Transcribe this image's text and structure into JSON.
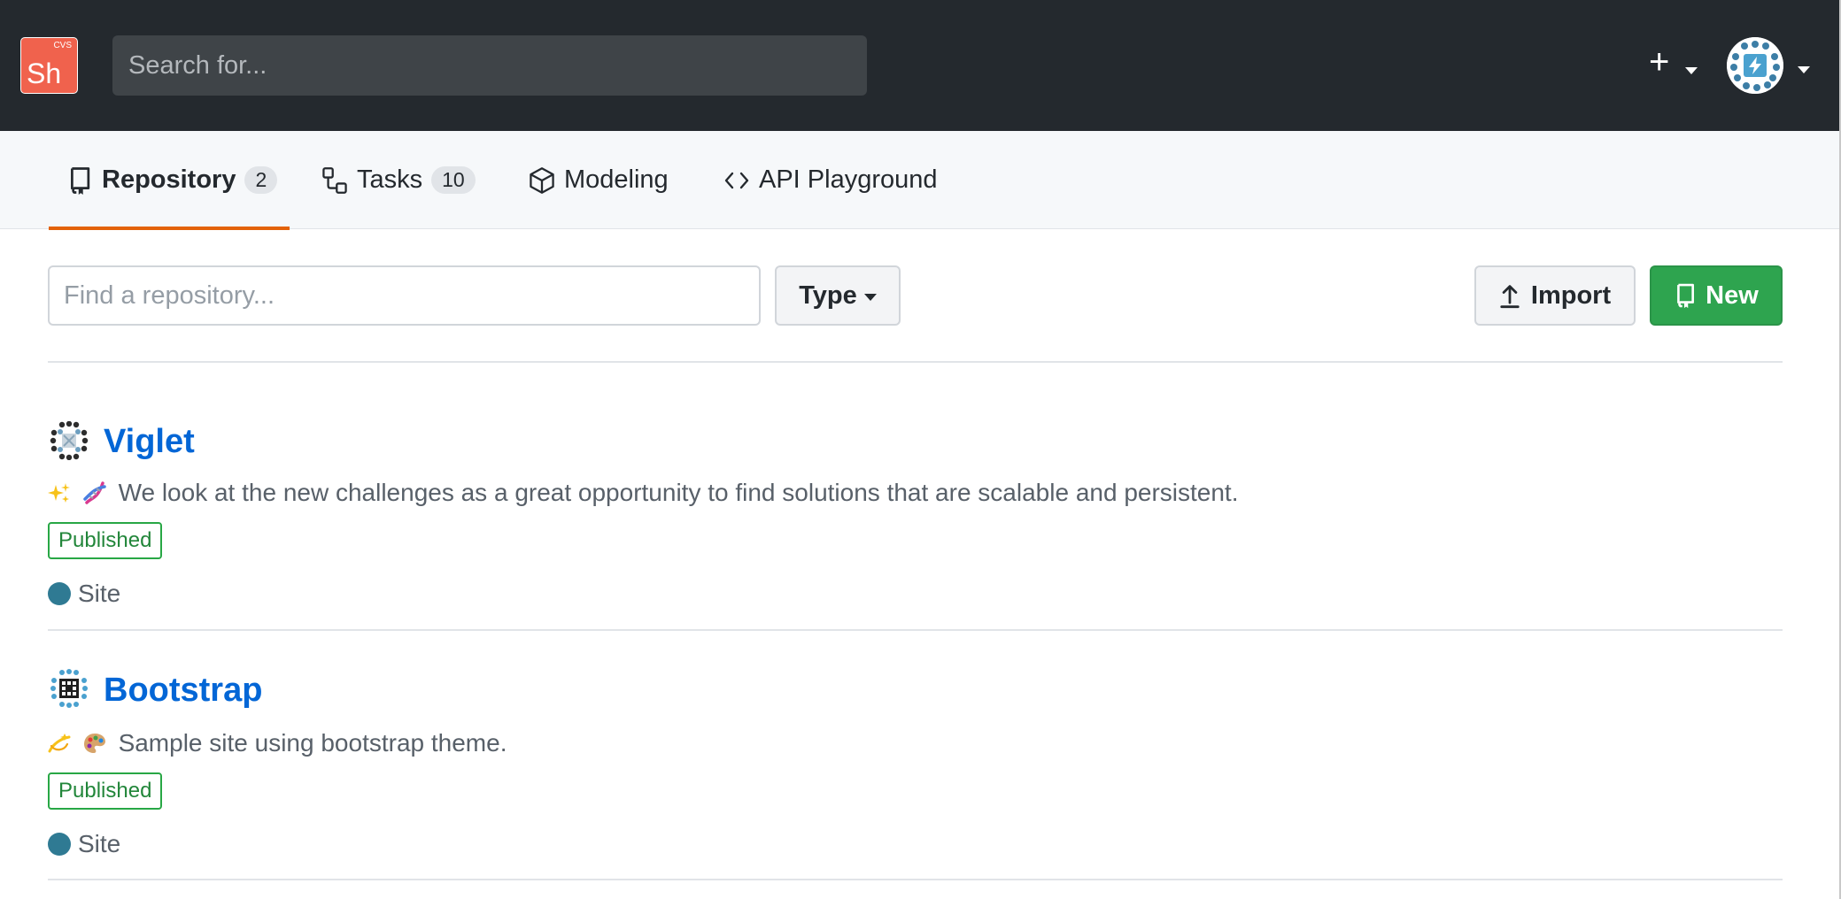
{
  "header": {
    "logo": {
      "text": "Sh",
      "sup": "CVS",
      "color": "#f0624d"
    },
    "search": {
      "placeholder": "Search for..."
    },
    "create_icon": "plus-icon",
    "avatar_icon": "user-avatar"
  },
  "tabs": [
    {
      "label": "Repository",
      "count": "2",
      "icon": "repo-icon",
      "active": true
    },
    {
      "label": "Tasks",
      "count": "10",
      "icon": "workflow-icon"
    },
    {
      "label": "Modeling",
      "icon": "cube-icon"
    },
    {
      "label": "API Playground",
      "icon": "code-icon"
    }
  ],
  "filter": {
    "find_placeholder": "Find a repository...",
    "type_label": "Type",
    "import_label": "Import",
    "new_label": "New"
  },
  "repositories": [
    {
      "name": "Viglet",
      "emojis": [
        "sparkles",
        "dna"
      ],
      "description": "We look at the new challenges as a great opportunity to find solutions that are scalable and persistent.",
      "status": "Published",
      "type": "Site",
      "type_color": "#2f7a93"
    },
    {
      "name": "Bootstrap",
      "emojis": [
        "dizzy",
        "artist-palette"
      ],
      "description": "Sample site using bootstrap theme.",
      "status": "Published",
      "type": "Site",
      "type_color": "#2f7a93"
    }
  ],
  "colors": {
    "header_bg": "#24292e",
    "tab_underline": "#e36209",
    "link": "#0366d6",
    "primary_button": "#2ea44f",
    "published": "#22863a"
  }
}
